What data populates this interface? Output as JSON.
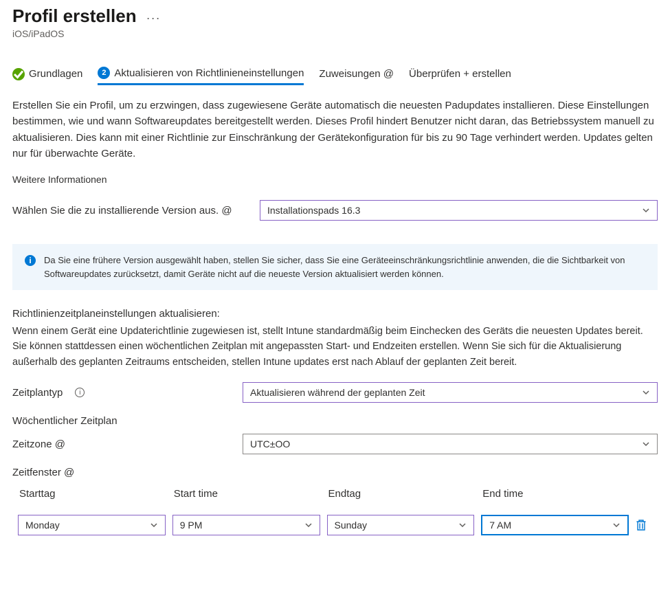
{
  "header": {
    "title": "Profil erstellen",
    "subtitle": "iOS/iPadOS"
  },
  "tabs": {
    "basics": "Grundlagen",
    "update_settings": "Aktualisieren von Richtlinieneinstellungen",
    "assignments": "Zuweisungen @",
    "review": "Überprüfen + erstellen",
    "step_number": "2"
  },
  "intro": {
    "paragraph": "Erstellen Sie ein Profil, um zu erzwingen, dass zugewiesene Geräte automatisch die neuesten Padupdates installieren. Diese Einstellungen bestimmen, wie und wann Softwareupdates bereitgestellt werden. Dieses Profil hindert Benutzer nicht daran, das Betriebssystem manuell zu aktualisieren. Dies kann mit einer Richtlinie zur Einschränkung der Gerätekonfiguration für bis zu 90 Tage verhindert werden. Updates gelten nur für überwachte Geräte.",
    "more_info": "Weitere Informationen"
  },
  "version": {
    "label": "Wählen Sie die zu installierende Version aus. @",
    "value": "Installationspads 16.3"
  },
  "info_banner": "Da Sie eine frühere Version ausgewählt haben, stellen Sie sicher, dass Sie eine Geräteeinschränkungsrichtlinie anwenden, die die Sichtbarkeit von Softwareupdates zurücksetzt, damit Geräte nicht auf die neueste Version aktualisiert werden können.",
  "schedule": {
    "heading": "Richtlinienzeitplaneinstellungen aktualisieren:",
    "body": "Wenn einem Gerät eine Updaterichtlinie zugewiesen ist, stellt Intune standardmäßig beim Einchecken des Geräts die neuesten Updates bereit. Sie können stattdessen einen wöchentlichen Zeitplan mit angepassten Start- und Endzeiten erstellen. Wenn Sie sich für die Aktualisierung außerhalb des geplanten Zeitraums entscheiden, stellen Intune updates erst nach Ablauf der geplanten Zeit bereit.",
    "type_label": "Zeitplantyp",
    "type_value": "Aktualisieren während der geplanten Zeit",
    "weekly_label": "Wöchentlicher Zeitplan",
    "tz_label": "Zeitzone @",
    "tz_value": "UTC±OO",
    "windows_label": "Zeitfenster @"
  },
  "timewindow": {
    "headers": {
      "start_day": "Starttag",
      "start_time": "Start time",
      "end_day": "Endtag",
      "end_time": "End time"
    },
    "row": {
      "start_day": "Monday",
      "start_time": "9 PM",
      "end_day": "Sunday",
      "end_time": "7 AM"
    }
  }
}
